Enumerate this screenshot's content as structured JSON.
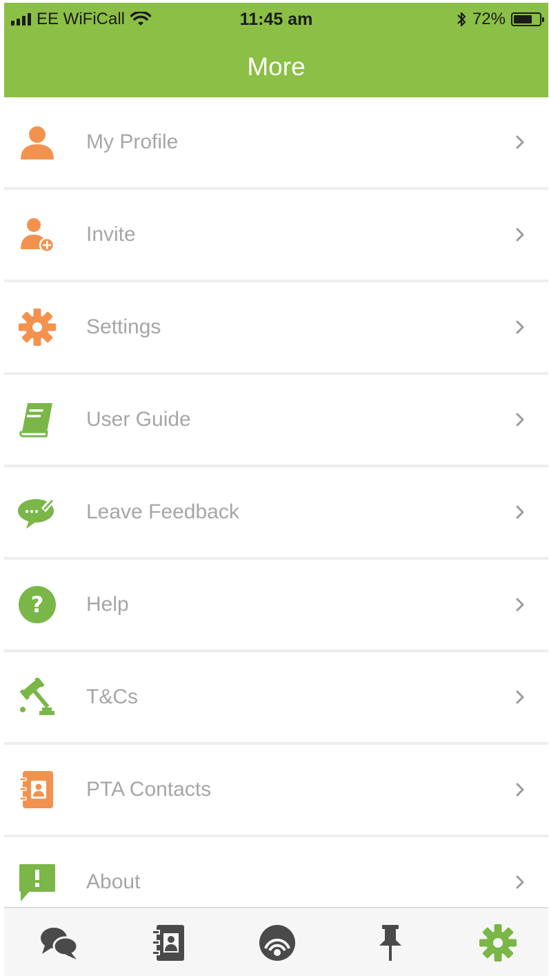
{
  "status_bar": {
    "carrier": "EE WiFiCall",
    "time": "11:45 am",
    "battery": "72%",
    "battery_level": 0.72
  },
  "header": {
    "title": "More"
  },
  "menu": [
    {
      "label": "My Profile",
      "icon": "profile-icon",
      "color": "#f3924f"
    },
    {
      "label": "Invite",
      "icon": "invite-user-icon",
      "color": "#f3924f"
    },
    {
      "label": "Settings",
      "icon": "gear-icon",
      "color": "#f3924f"
    },
    {
      "label": "User Guide",
      "icon": "book-icon",
      "color": "#7ab648"
    },
    {
      "label": "Leave Feedback",
      "icon": "feedback-bubble-icon",
      "color": "#7ab648"
    },
    {
      "label": "Help",
      "icon": "question-icon",
      "color": "#7ab648"
    },
    {
      "label": "T&Cs",
      "icon": "gavel-icon",
      "color": "#7ab648"
    },
    {
      "label": "PTA Contacts",
      "icon": "contacts-book-icon",
      "color": "#f3924f"
    },
    {
      "label": "About",
      "icon": "exclamation-bubble-icon",
      "color": "#7ab648"
    }
  ],
  "tabbar": {
    "tabs": [
      {
        "icon": "chat-bubbles-icon",
        "active": false
      },
      {
        "icon": "address-book-icon",
        "active": false
      },
      {
        "icon": "broadcast-icon",
        "active": false
      },
      {
        "icon": "pin-icon",
        "active": false
      },
      {
        "icon": "gear-icon",
        "active": true
      }
    ]
  },
  "colors": {
    "accent": "#8bbf45",
    "orange": "#f3924f",
    "green": "#7ab648",
    "tab_inactive": "#4a4a4a"
  }
}
